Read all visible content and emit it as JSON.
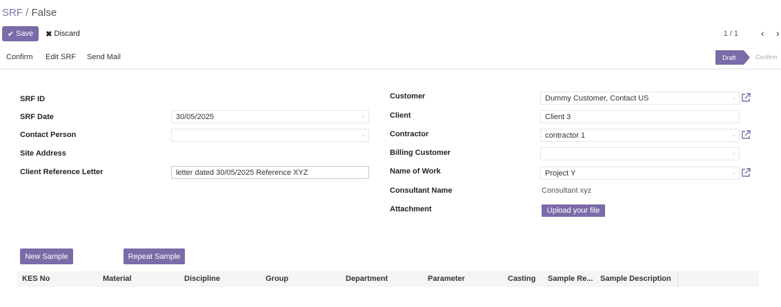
{
  "breadcrumb": {
    "main": "SRF",
    "separator": "/",
    "current": "False"
  },
  "toolbar": {
    "save_label": "Save",
    "discard_label": "Discard"
  },
  "pager": {
    "value": "1 / 1"
  },
  "actions": {
    "confirm": "Confirm",
    "edit_srf": "Edit SRF",
    "send_mail": "Send Mail"
  },
  "status": {
    "draft": "Draft",
    "confirm": "Confirm",
    "active": "Draft"
  },
  "form": {
    "srf_id": {
      "label": "SRF ID",
      "value": ""
    },
    "srf_date": {
      "label": "SRF Date",
      "value": "30/05/2025"
    },
    "contact_person": {
      "label": "Contact Person",
      "value": ""
    },
    "site_address": {
      "label": "Site Address",
      "value": ""
    },
    "client_reference_letter": {
      "label": "Client Reference Letter",
      "value": "letter dated 30/05/2025 Reference XYZ"
    },
    "customer": {
      "label": "Customer",
      "value": "Dummy Customer, Contact US"
    },
    "client": {
      "label": "Client",
      "value": "Client 3"
    },
    "contractor": {
      "label": "Contractor",
      "value": "contractor 1"
    },
    "billing_customer": {
      "label": "Billing Customer",
      "value": ""
    },
    "name_of_work": {
      "label": "Name of Work",
      "value": "Project Y"
    },
    "consultant_name": {
      "label": "Consultant Name",
      "value": "Consultant xyz"
    },
    "attachment": {
      "label": "Attachment",
      "upload_label": "Upload your file"
    }
  },
  "samples": {
    "new_sample_label": "New Sample",
    "repeat_sample_label": "Repeat Sample",
    "columns": [
      "KES No",
      "Material",
      "Discipline",
      "Group",
      "Department",
      "Parameter",
      "Casting",
      "Sample Re...",
      "Sample Description"
    ]
  },
  "colors": {
    "accent": "#7b6ba8"
  },
  "icons": {
    "save": "check-icon",
    "discard": "times-icon",
    "prev": "chevron-left-icon",
    "next": "chevron-right-icon",
    "external": "external-link-icon",
    "dropdown": "caret-down-icon"
  }
}
